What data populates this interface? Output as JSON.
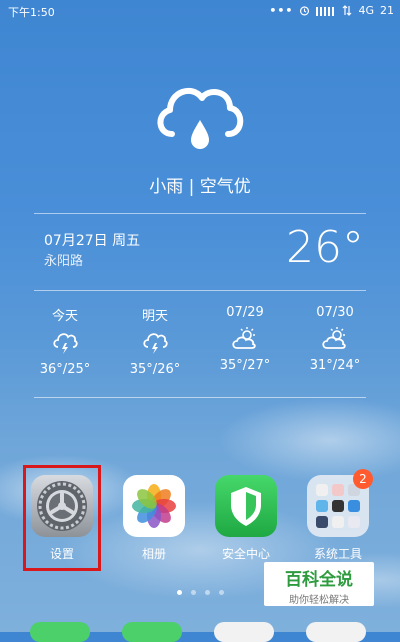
{
  "status_bar": {
    "time": "下午1:50",
    "dots": "•••",
    "network": "4G",
    "battery": "21"
  },
  "weather": {
    "summary": "小雨 | 空气优",
    "date": "07月27日 周五",
    "location": "永阳路",
    "current_temp": "26°",
    "forecast": [
      {
        "label": "今天",
        "icon": "thunder-rain-icon",
        "temps": "36°/25°"
      },
      {
        "label": "明天",
        "icon": "thunder-rain-icon",
        "temps": "35°/26°"
      },
      {
        "label": "07/29",
        "icon": "partly-cloudy-icon",
        "temps": "35°/27°"
      },
      {
        "label": "07/30",
        "icon": "partly-cloudy-icon",
        "temps": "31°/24°"
      }
    ]
  },
  "apps": [
    {
      "label": "设置",
      "icon": "settings-gear-icon"
    },
    {
      "label": "相册",
      "icon": "photos-flower-icon"
    },
    {
      "label": "安全中心",
      "icon": "security-shield-icon"
    },
    {
      "label": "系统工具",
      "icon": "system-tools-folder-icon",
      "badge": "2"
    }
  ],
  "watermark": {
    "title": "百科全说",
    "subtitle": "助你轻松解决"
  },
  "colors": {
    "highlight": "#d9181c",
    "badge": "#ff5b2e",
    "watermark_green": "#2e9b3f"
  }
}
